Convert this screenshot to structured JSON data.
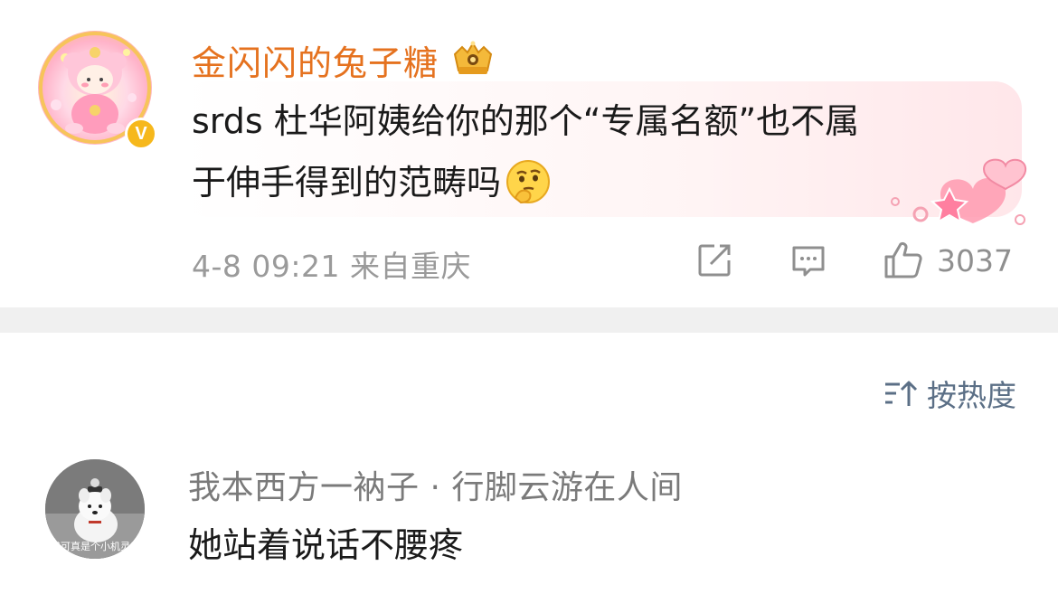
{
  "post": {
    "username": "金闪闪的兔子糖",
    "verified_badge": "V",
    "content_line1": "srds 杜华阿姨给你的那个“专属名额”也不属",
    "content_line2": "于伸手得到的范畴吗",
    "emoji": "thinking-face",
    "timestamp": "4-8 09:21",
    "location": "来自重庆",
    "like_count": "3037",
    "icons": {
      "share": "share-icon",
      "comment": "comment-icon",
      "like": "thumbs-up-icon",
      "vip": "crown-badge-icon"
    },
    "colors": {
      "username": "#e5721f",
      "verified": "#f6b81c"
    }
  },
  "sort": {
    "label": "按热度",
    "icon": "sort-icon"
  },
  "comment": {
    "username": "我本西方一衲子 · 行脚云游在人间",
    "text": "她站着说话不腰疼",
    "avatar_caption": "我可真是个小机灵鬼"
  }
}
